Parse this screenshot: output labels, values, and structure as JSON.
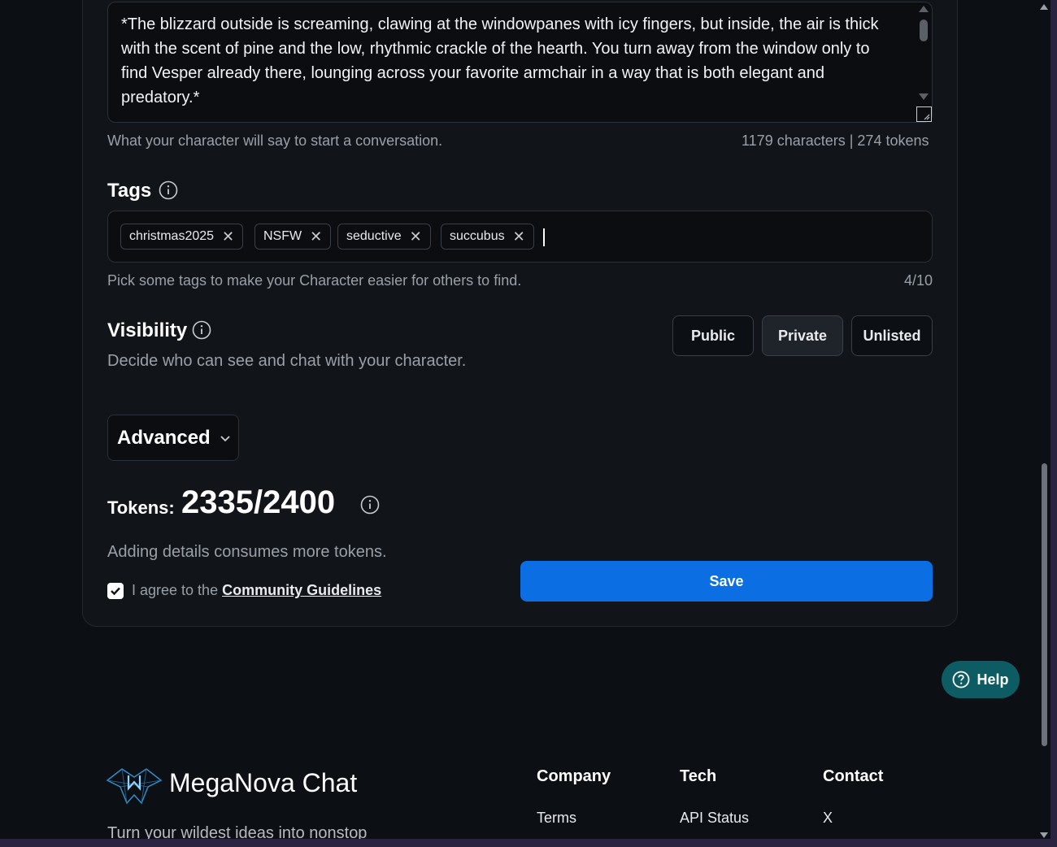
{
  "greeting": {
    "text": "*The blizzard outside is screaming, clawing at the windowpanes with icy fingers, but inside, the air is thick with the scent of pine and the low, rhythmic crackle of the hearth. You turn away from the window only to find Vesper already there, lounging across your favorite armchair in a way that is both elegant and predatory.*",
    "hint": "What your character will say to start a conversation.",
    "count": "1179 characters | 274 tokens"
  },
  "tags": {
    "title": "Tags",
    "items": [
      "christmas2025",
      "NSFW",
      "seductive",
      "succubus"
    ],
    "remove_glyph": "✕",
    "hint": "Pick some tags to make your Character easier for others to find.",
    "count": "4/10"
  },
  "visibility": {
    "title": "Visibility",
    "description": "Decide who can see and chat with your character.",
    "options": [
      "Public",
      "Private",
      "Unlisted"
    ],
    "selected": "Private"
  },
  "advanced": {
    "label": "Advanced"
  },
  "tokens": {
    "label": "Tokens:",
    "value": "2335/2400",
    "hint": "Adding details consumes more tokens."
  },
  "agreement": {
    "prefix": "I agree to the ",
    "link": "Community Guidelines",
    "checked": true
  },
  "save": {
    "label": "Save"
  },
  "help": {
    "label": "Help"
  },
  "footer": {
    "brand": "MegaNova Chat",
    "tagline": "Turn your wildest ideas into nonstop",
    "columns": [
      {
        "title": "Company",
        "links": [
          "Terms"
        ]
      },
      {
        "title": "Tech",
        "links": [
          "API Status"
        ]
      },
      {
        "title": "Contact",
        "links": [
          "X"
        ]
      }
    ]
  },
  "colors": {
    "background": "#0c0f14",
    "card": "#111419",
    "primary": "#0b6fe3",
    "help": "#0d5c63"
  }
}
